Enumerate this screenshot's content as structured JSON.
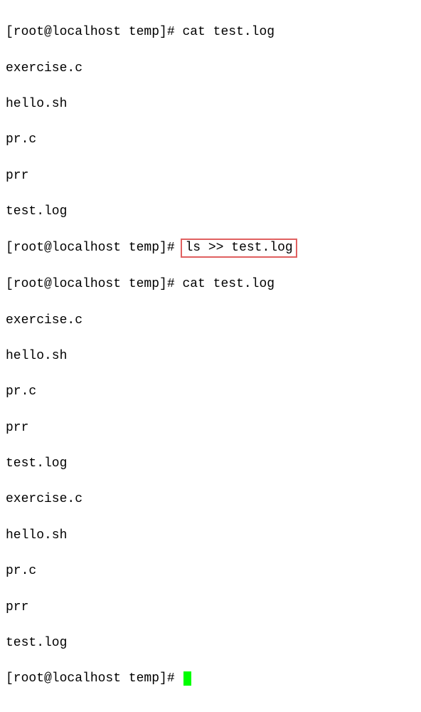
{
  "prompt": {
    "text": "[root@localhost temp]# "
  },
  "lines": {
    "l0_cmd": "cat test.log",
    "l1": "exercise.c",
    "l2": "hello.sh",
    "l3": "pr.c",
    "l4": "prr",
    "l5": "test.log",
    "l6_cmd": "ls >> test.log",
    "l7_cmd": "cat test.log",
    "l8": "exercise.c",
    "l9": "hello.sh",
    "l10": "pr.c",
    "l11": "prr",
    "l12": "test.log",
    "l13": "exercise.c",
    "l14": "hello.sh",
    "l15": "pr.c",
    "l16": "prr",
    "l17": "test.log"
  }
}
